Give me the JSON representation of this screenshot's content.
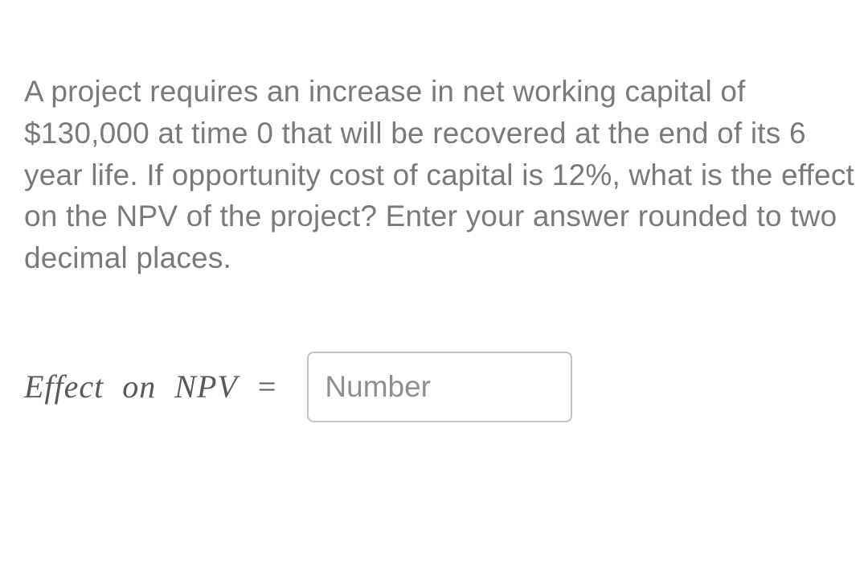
{
  "question": {
    "text": "A project requires an increase in net working capital of $130,000 at time 0 that will be recovered at the end of its 6 year life. If opportunity cost of capital is 12%, what is the effect on the NPV of the project?  Enter your answer rounded to two decimal places."
  },
  "answer": {
    "label": "Effect on NPV =",
    "placeholder": "Number",
    "value": ""
  }
}
